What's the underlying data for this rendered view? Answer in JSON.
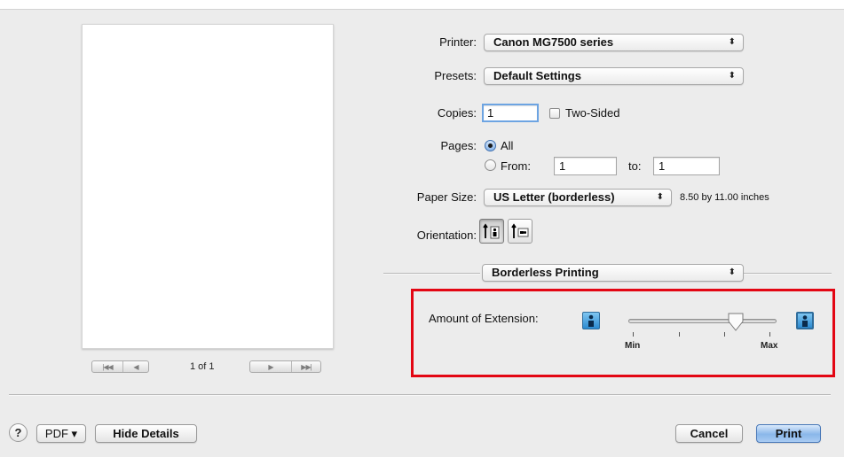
{
  "preview": {
    "page_indicator": "1 of 1"
  },
  "printer": {
    "label": "Printer:",
    "value": "Canon MG7500 series"
  },
  "presets": {
    "label": "Presets:",
    "value": "Default Settings"
  },
  "copies": {
    "label": "Copies:",
    "value": "1",
    "two_sided_label": "Two-Sided"
  },
  "pages": {
    "label": "Pages:",
    "all_label": "All",
    "from_label": "From:",
    "from_value": "1",
    "to_label": "to:",
    "to_value": "1"
  },
  "paper_size": {
    "label": "Paper Size:",
    "value": "US Letter (borderless)",
    "dimensions": "8.50 by 11.00 inches"
  },
  "orientation": {
    "label": "Orientation:"
  },
  "section": {
    "value": "Borderless Printing"
  },
  "extension": {
    "label": "Amount of Extension:",
    "min_label": "Min",
    "max_label": "Max",
    "slider_level": 0.75
  },
  "footer": {
    "help_label": "?",
    "pdf_label": "PDF ▾",
    "hide_details_label": "Hide Details",
    "cancel_label": "Cancel",
    "print_label": "Print"
  },
  "colors": {
    "highlight_border": "#e30613",
    "default_button": "#8ab7ea"
  }
}
